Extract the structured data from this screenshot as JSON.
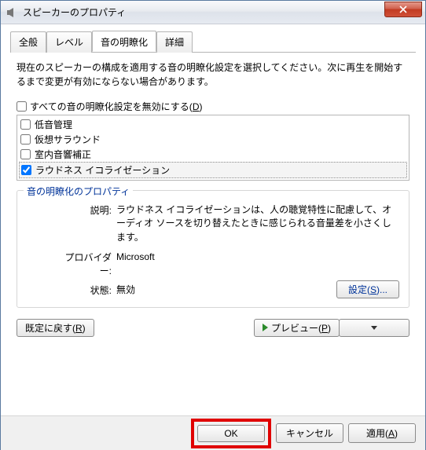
{
  "window": {
    "title": "スピーカーのプロパティ"
  },
  "tabs": [
    {
      "label": "全般"
    },
    {
      "label": "レベル"
    },
    {
      "label": "音の明瞭化"
    },
    {
      "label": "詳細"
    }
  ],
  "description": "現在のスピーカーの構成を適用する音の明瞭化設定を選択してください。次に再生を開始するまで変更が有効にならない場合があります。",
  "disable_all": {
    "label_pre": "すべての音の明瞭化設定を無効にする(",
    "accel": "D",
    "label_post": ")"
  },
  "enhancements": [
    {
      "label": "低音管理",
      "checked": false
    },
    {
      "label": "仮想サラウンド",
      "checked": false
    },
    {
      "label": "室内音響補正",
      "checked": false
    },
    {
      "label": "ラウドネス イコライゼーション",
      "checked": true
    }
  ],
  "props": {
    "title": "音の明瞭化のプロパティ",
    "desc_label": "説明:",
    "desc_value": "ラウドネス イコライゼーションは、人の聴覚特性に配慮して、オーディオ ソースを切り替えたときに感じられる音量差を小さくします。",
    "provider_label": "プロバイダー:",
    "provider_value": "Microsoft",
    "status_label": "状態:",
    "status_value": "無効",
    "settings_pre": "設定(",
    "settings_accel": "S",
    "settings_post": ")..."
  },
  "buttons": {
    "restore_pre": "既定に戻す(",
    "restore_accel": "R",
    "restore_post": ")",
    "preview_pre": "プレビュー(",
    "preview_accel": "P",
    "preview_post": ")",
    "ok": "OK",
    "cancel": "キャンセル",
    "apply_pre": "適用(",
    "apply_accel": "A",
    "apply_post": ")"
  }
}
